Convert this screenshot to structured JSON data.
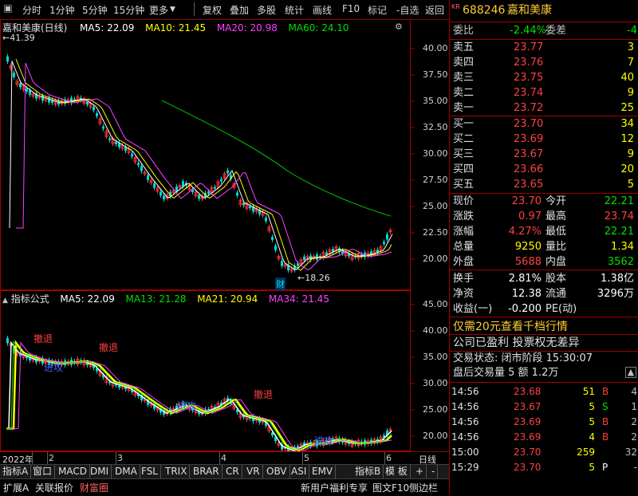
{
  "toolbar": {
    "items": [
      "分时",
      "1分钟",
      "5分钟",
      "15分钟",
      "更多",
      "复权",
      "叠加",
      "多股",
      "统计",
      "画线",
      "F10",
      "标记",
      "-自选",
      "返回"
    ]
  },
  "header": {
    "kr_badge": "KR",
    "code": "688246",
    "name": "嘉和美康"
  },
  "main_chart": {
    "title": "嘉和美康(日线)",
    "ma": [
      {
        "label": "MA5: 22.09",
        "color": "#ffffff"
      },
      {
        "label": "MA10: 21.45",
        "color": "#ffff00"
      },
      {
        "label": "MA20: 20.98",
        "color": "#ff40ff"
      },
      {
        "label": "MA60: 24.10",
        "color": "#00e000"
      }
    ],
    "high_label": "41.39",
    "low_label": "18.26",
    "cai_label": "财",
    "y_ticks": [
      "40.00",
      "37.50",
      "35.00",
      "32.50",
      "30.00",
      "27.50",
      "25.00",
      "22.50",
      "20.00"
    ]
  },
  "sub_chart": {
    "title": "指标公式",
    "ma": [
      {
        "label": "MA5: 22.09",
        "color": "#ffffff"
      },
      {
        "label": "MA13: 21.28",
        "color": "#00e000"
      },
      {
        "label": "MA21: 20.94",
        "color": "#ffff00"
      },
      {
        "label": "MA34: 21.45",
        "color": "#ff40ff"
      }
    ],
    "y_ticks": [
      "45.00",
      "40.00",
      "35.00",
      "30.00",
      "25.00",
      "20.00"
    ],
    "signals": [
      {
        "text": "撤退",
        "color": "#ff4040"
      },
      {
        "text": "进攻",
        "color": "#4040ff"
      },
      {
        "text": "撤退",
        "color": "#ff4040"
      },
      {
        "text": "进攻",
        "color": "#4040ff"
      },
      {
        "text": "撤退",
        "color": "#ff4040"
      },
      {
        "text": "进攻",
        "color": "#4040ff"
      }
    ]
  },
  "x_axis": {
    "labels": [
      "2022年",
      "2",
      "3",
      "4",
      "5",
      "6"
    ],
    "period": "日线"
  },
  "indicator_tabs": [
    "指标A",
    "窗口",
    "MACD",
    "DMI",
    "DMA",
    "FSL",
    "TRIX",
    "BRAR",
    "CR",
    "VR",
    "OBV",
    "ASI",
    "EMV",
    "指标B",
    "模 板",
    "+",
    "-"
  ],
  "status_bar": {
    "left": [
      "扩展A",
      "关联报价",
      "财富圈"
    ],
    "right": [
      "新用户福利专享",
      "图文F10",
      "侧边栏"
    ],
    "icons": [
      "笔",
      "价",
      "细",
      "势",
      "联",
      "值",
      "主",
      "筹"
    ]
  },
  "quote_panel": {
    "weibi": {
      "label": "委比",
      "value": "-2.44%",
      "label2": "委差",
      "value2": "-4"
    },
    "sells": [
      {
        "label": "卖五",
        "price": "23.77",
        "vol": "3"
      },
      {
        "label": "卖四",
        "price": "23.76",
        "vol": "7"
      },
      {
        "label": "卖三",
        "price": "23.75",
        "vol": "40"
      },
      {
        "label": "卖二",
        "price": "23.74",
        "vol": "9"
      },
      {
        "label": "卖一",
        "price": "23.72",
        "vol": "25"
      }
    ],
    "buys": [
      {
        "label": "买一",
        "price": "23.70",
        "vol": "34"
      },
      {
        "label": "买二",
        "price": "23.69",
        "vol": "12"
      },
      {
        "label": "买三",
        "price": "23.67",
        "vol": "9"
      },
      {
        "label": "买四",
        "price": "23.66",
        "vol": "20"
      },
      {
        "label": "买五",
        "price": "23.65",
        "vol": "5"
      }
    ],
    "stats": [
      {
        "l1": "现价",
        "v1": "23.70",
        "l2": "今开",
        "v2": "22.21"
      },
      {
        "l1": "涨跌",
        "v1": "0.97",
        "l2": "最高",
        "v2": "23.74"
      },
      {
        "l1": "涨幅",
        "v1": "4.27%",
        "l2": "最低",
        "v2": "22.21"
      },
      {
        "l1": "总量",
        "v1": "9250",
        "l2": "量比",
        "v2": "1.34"
      },
      {
        "l1": "外盘",
        "v1": "5688",
        "l2": "内盘",
        "v2": "3562"
      }
    ],
    "stats2": [
      {
        "l1": "换手",
        "v1": "2.81%",
        "l2": "股本",
        "v2": "1.38亿"
      },
      {
        "l1": "净资",
        "v1": "12.38",
        "l2": "流通",
        "v2": "3296万"
      },
      {
        "l1": "收益(一)",
        "v1": "-0.200",
        "l2": "PE(动)",
        "v2": ""
      }
    ],
    "promo": "仅需20元查看千档行情",
    "notice": "公司已盈利 投票权无差异",
    "trade_state": "交易状态: 闭市阶段 15:30:07",
    "after_hours": "盘后交易量 5 额 1.2万",
    "ticks": [
      {
        "time": "14:56",
        "price": "23.68",
        "vol": "51",
        "bs": "B",
        "extra": "4"
      },
      {
        "time": "14:56",
        "price": "23.67",
        "vol": "5",
        "bs": "S",
        "extra": "1"
      },
      {
        "time": "14:56",
        "price": "23.69",
        "vol": "5",
        "bs": "B",
        "extra": "2"
      },
      {
        "time": "14:56",
        "price": "23.69",
        "vol": "4",
        "bs": "B",
        "extra": "2"
      },
      {
        "time": "15:00",
        "price": "23.70",
        "vol": "259",
        "bs": "",
        "extra": "32"
      },
      {
        "time": "15:29",
        "price": "23.70",
        "vol": "5",
        "bs": "P",
        "extra": "-"
      }
    ]
  }
}
